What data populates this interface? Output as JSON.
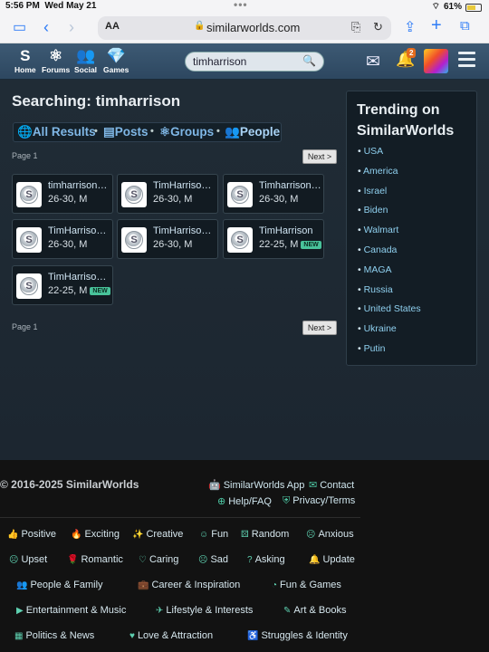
{
  "status": {
    "time": "5:56 PM",
    "date": "Wed May 21",
    "battery": "61%"
  },
  "browser": {
    "aa": "AA",
    "url": "similarworlds.com"
  },
  "nav": {
    "items": [
      {
        "label": "Home",
        "icon": "S"
      },
      {
        "label": "Forums",
        "icon": "⚛"
      },
      {
        "label": "Social",
        "icon": "👥"
      },
      {
        "label": "Games",
        "icon": "💎"
      }
    ],
    "search_value": "timharrison",
    "notification_count": "2"
  },
  "main": {
    "heading": "Searching: timharrison",
    "tabs": [
      {
        "label": "All Results",
        "icon": "🌐"
      },
      {
        "label": "Posts",
        "icon": "▤"
      },
      {
        "label": "Groups",
        "icon": "⚛"
      },
      {
        "label": "People",
        "icon": "👥"
      }
    ],
    "page_label": "Page 1",
    "next_label": "Next >",
    "new_label": "NEW",
    "results": [
      {
        "name": "timharrison…",
        "age": "26-30, M",
        "new": false
      },
      {
        "name": "TimHarriso…",
        "age": "26-30, M",
        "new": false
      },
      {
        "name": "Timharrison…",
        "age": "26-30, M",
        "new": false
      },
      {
        "name": "TimHarriso…",
        "age": "26-30, M",
        "new": false
      },
      {
        "name": "TimHarriso…",
        "age": "26-30, M",
        "new": false
      },
      {
        "name": "TimHarrison",
        "age": "22-25, M",
        "new": true
      },
      {
        "name": "TimHarriso…",
        "age": "22-25, M",
        "new": true
      }
    ]
  },
  "trending": {
    "title": "Trending on SimilarWorlds",
    "items": [
      "USA",
      "America",
      "Israel",
      "Biden",
      "Walmart",
      "Canada",
      "MAGA",
      "Russia",
      "United States",
      "Ukraine",
      "Putin"
    ]
  },
  "footer": {
    "copyright": "© 2016-2025 SimilarWorlds",
    "app": "SimilarWorlds App",
    "contact": "Contact",
    "help": "Help/FAQ",
    "privacy": "Privacy/Terms",
    "categories": [
      {
        "label": "Positive",
        "icon": "👍"
      },
      {
        "label": "Exciting",
        "icon": "🔥"
      },
      {
        "label": "Creative",
        "icon": "✨"
      },
      {
        "label": "Fun",
        "icon": "☺"
      },
      {
        "label": "Random",
        "icon": "⚄"
      },
      {
        "label": "Anxious",
        "icon": "☹"
      },
      {
        "label": "Upset",
        "icon": "☹"
      },
      {
        "label": "Romantic",
        "icon": "🌹"
      },
      {
        "label": "Caring",
        "icon": "♡"
      },
      {
        "label": "Sad",
        "icon": "☹"
      },
      {
        "label": "Asking",
        "icon": "?"
      },
      {
        "label": "Update",
        "icon": "🔔"
      },
      {
        "label": "People & Family",
        "icon": "👥"
      },
      {
        "label": "Career & Inspiration",
        "icon": "💼"
      },
      {
        "label": "Fun & Games",
        "icon": "◔"
      },
      {
        "label": "Entertainment & Music",
        "icon": "▶"
      },
      {
        "label": "Lifestyle & Interests",
        "icon": "✈"
      },
      {
        "label": "Art & Books",
        "icon": "✎"
      },
      {
        "label": "Politics & News",
        "icon": "▦"
      },
      {
        "label": "Love & Attraction",
        "icon": "♥"
      },
      {
        "label": "Struggles & Identity",
        "icon": "♿"
      }
    ]
  }
}
